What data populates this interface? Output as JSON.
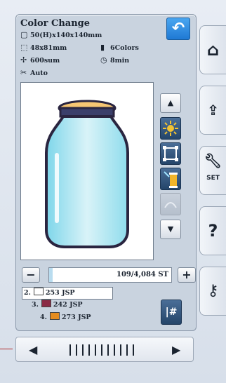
{
  "title": "Color Change",
  "info": {
    "hoop": "50(H)x140x140mm",
    "size": "48x81mm",
    "colors": "6Colors",
    "stitches": "600sum",
    "time": "8min",
    "mode": "Auto"
  },
  "stitch": {
    "value": "109/4,084 ST",
    "progress": 0.03
  },
  "colors_list": [
    {
      "index": "2.",
      "code": "253",
      "brand": "JSP",
      "swatch": "#ffffff",
      "selected": true
    },
    {
      "index": "3.",
      "code": "242",
      "brand": "JSP",
      "swatch": "#8a2a45",
      "selected": false
    },
    {
      "index": "4.",
      "code": "273",
      "brand": "JSP",
      "swatch": "#e58c1f",
      "selected": false
    }
  ],
  "buttons": {
    "minus": "−",
    "plus": "+",
    "up": "▲",
    "down": "▼",
    "cmd": "|#"
  },
  "rail": {
    "set_label": "SET",
    "question": "?"
  },
  "icons": {
    "back": "back-arrow-icon",
    "home": "home-icon",
    "export": "folder-export-icon",
    "settings": "wrench-icon",
    "help": "question-icon",
    "key": "key-icon",
    "bulb": "sparkle-icon",
    "frame": "frame-icon",
    "thread": "thread-spool-icon",
    "shape": "shape-icon"
  },
  "colors": {
    "accent": "#1f79d4",
    "panel": "#c9d3df",
    "tool": "#2c4f78"
  }
}
